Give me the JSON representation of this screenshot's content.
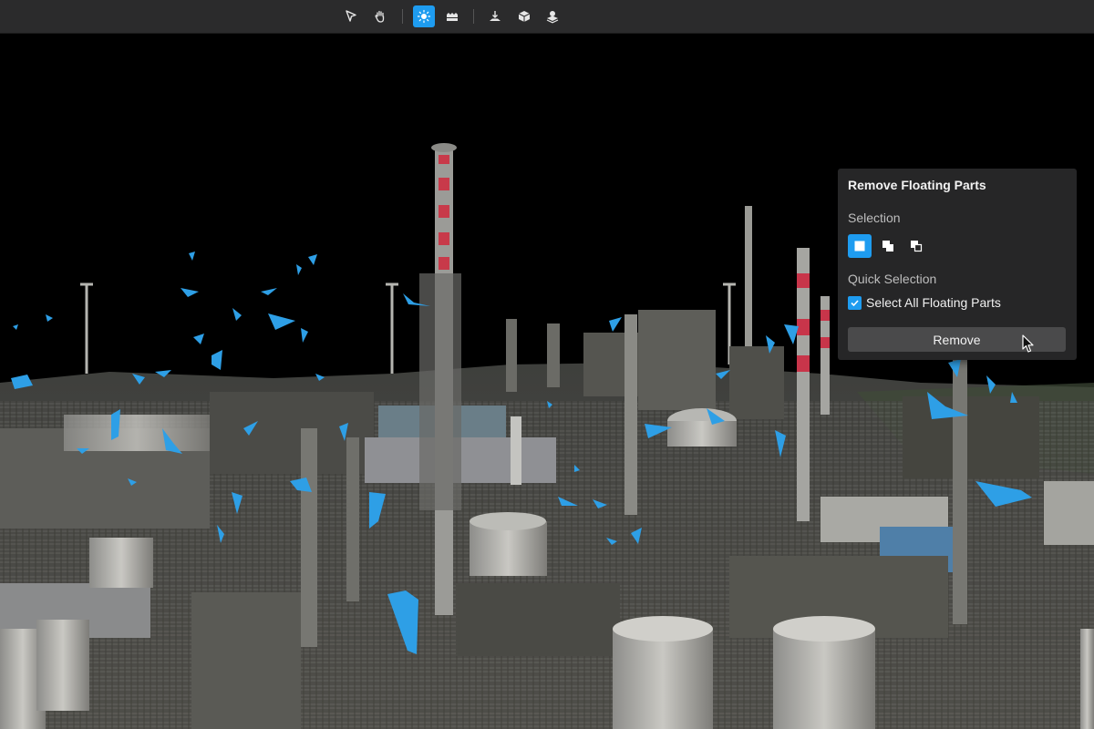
{
  "toolbar": {
    "tools": [
      {
        "icon": "pointer-arrow-icon",
        "active": false
      },
      {
        "icon": "pan-hand-icon",
        "active": false
      },
      {
        "icon": "floating-parts-icon",
        "active": true
      },
      {
        "icon": "layers-flat-icon",
        "active": false
      },
      {
        "icon": "ground-plane-icon",
        "active": false
      },
      {
        "icon": "cube-icon",
        "active": false
      },
      {
        "icon": "stacked-layers-icon",
        "active": false
      }
    ]
  },
  "panel": {
    "title": "Remove Floating Parts",
    "selection_label": "Selection",
    "selection_modes": [
      {
        "icon": "select-replace-icon",
        "active": true
      },
      {
        "icon": "select-add-icon",
        "active": false
      },
      {
        "icon": "select-subtract-icon",
        "active": false
      }
    ],
    "quick_selection_label": "Quick Selection",
    "select_all_label": "Select All Floating Parts",
    "select_all_checked": true,
    "remove_label": "Remove"
  },
  "colors": {
    "accent": "#1e9cf0",
    "floating_parts": "#2e9fe6",
    "panel_bg": "#262627",
    "toolbar_bg": "#2b2b2c"
  }
}
